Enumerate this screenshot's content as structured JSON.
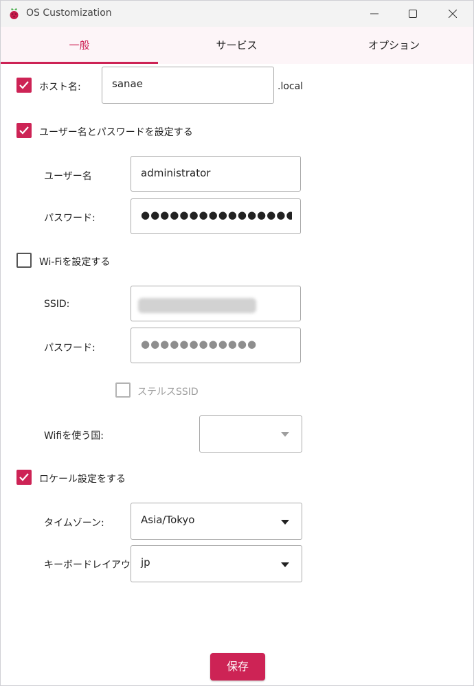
{
  "window": {
    "title": "OS Customization"
  },
  "tabs": [
    {
      "label": "一般",
      "active": true
    },
    {
      "label": "サービス",
      "active": false
    },
    {
      "label": "オプション",
      "active": false
    }
  ],
  "hostname": {
    "label": "ホスト名:",
    "checked": true,
    "value": "sanae",
    "suffix": ".local"
  },
  "user": {
    "label": "ユーザー名とパスワードを設定する",
    "checked": true,
    "username_label": "ユーザー名",
    "username_value": "administrator",
    "password_label": "パスワード:",
    "password_mask": "●●●●●●●●●●●●●●●●●●●●●●"
  },
  "wifi": {
    "label": "Wi-Fiを設定する",
    "checked": false,
    "ssid_label": "SSID:",
    "password_label": "パスワード:",
    "password_mask": "●●●●●●●●●●●●",
    "hidden_ssid_label": "ステルスSSID",
    "hidden_ssid_checked": false,
    "country_label": "Wifiを使う国:",
    "country_value": ""
  },
  "locale": {
    "label": "ロケール設定をする",
    "checked": true,
    "timezone_label": "タイムゾーン:",
    "timezone_value": "Asia/Tokyo",
    "keyboard_label": "キーボードレイアウト:",
    "keyboard_value": "jp"
  },
  "footer": {
    "save_label": "保存"
  },
  "colors": {
    "accent": "#cd2355",
    "tab_bg": "#fdf5f8"
  }
}
